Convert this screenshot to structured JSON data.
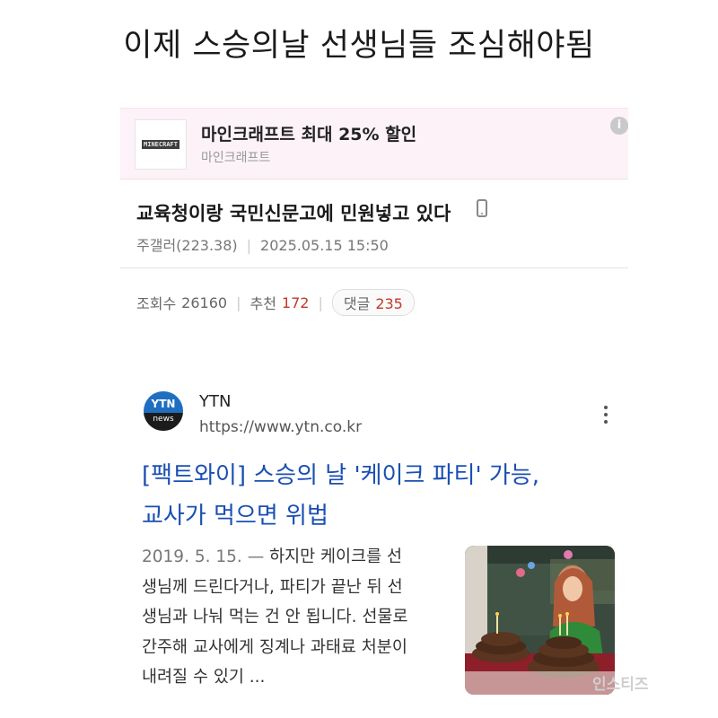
{
  "post": {
    "headline": "이제 스승의날 선생님들 조심해야됨",
    "title": "교육청이랑 국민신문고에 민원넣고 있다",
    "author": "주갤러(223.38)",
    "datetime": "2025.05.15 15:50",
    "views_label": "조회수",
    "views": "26160",
    "likes_label": "추천",
    "likes": "172",
    "comments_label": "댓글",
    "comments": "235"
  },
  "ad": {
    "logo_text": "MINECRAFT",
    "title": "마인크래프트 최대 25% 할인",
    "advertiser": "마인크래프트",
    "info_glyph": "i"
  },
  "search_result": {
    "logo_top": "YTN",
    "logo_bottom": "news",
    "source_name": "YTN",
    "source_url": "https://www.ytn.co.kr",
    "title_line1": "[팩트와이] 스승의 날 '케이크 파티' 가능,",
    "title_line2": "교사가 먹으면 위법",
    "date": "2019. 5. 15.",
    "date_sep": "—",
    "snippet_lines": [
      "하지만 케이크를 선",
      "생님께 드린다거나, 파티가 끝난 뒤 선",
      "생님과 나눠 먹는 건 안 됩니다. 선물로",
      "간주해 교사에게 징계나 과태료 처분이",
      "내려질 수 있기 ..."
    ]
  },
  "watermark": "인스티즈",
  "colors": {
    "link": "#1a4fb3",
    "ad_bg": "#fcf2f8",
    "count_red": "#c0392b",
    "ytn_blue": "#1f6fc0"
  },
  "icons": [
    "phone-icon",
    "info-icon",
    "more-vertical-icon"
  ]
}
